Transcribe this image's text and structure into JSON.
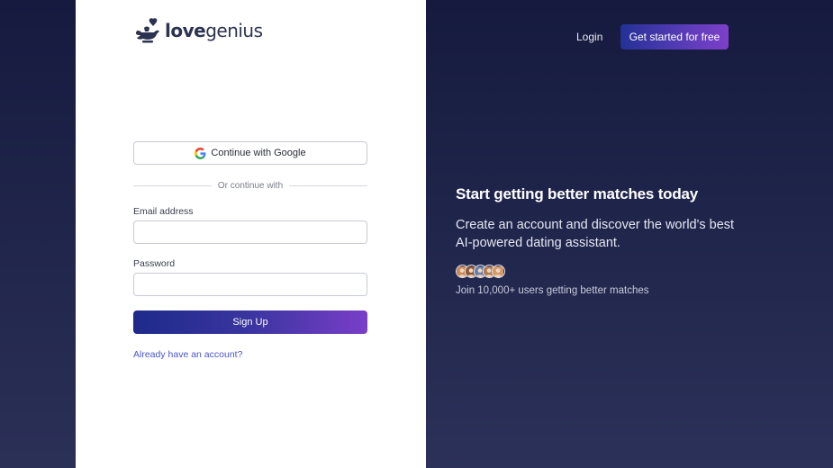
{
  "brand": {
    "name_bold": "love",
    "name_regular": "genius"
  },
  "auth": {
    "google_label": "Continue with Google",
    "divider_text": "Or continue with",
    "email_label": "Email address",
    "email_value": "",
    "password_label": "Password",
    "password_value": "",
    "submit_label": "Sign Up",
    "signin_link": "Already have an account?"
  },
  "nav": {
    "login_label": "Login",
    "cta_label": "Get started for free"
  },
  "hero": {
    "headline": "Start getting better matches today",
    "subheadline": "Create an account and discover the world's best AI-powered dating assistant.",
    "social_proof": "Join 10,000+ users getting better matches"
  },
  "avatars": [
    {
      "icon": "user-avatar-1",
      "color": "#c9895a"
    },
    {
      "icon": "user-avatar-2",
      "color": "#8a5a3c"
    },
    {
      "icon": "user-avatar-3",
      "color": "#6b7fa8"
    },
    {
      "icon": "user-avatar-4",
      "color": "#b07a52"
    },
    {
      "icon": "user-avatar-5",
      "color": "#d29a6a"
    }
  ],
  "colors": {
    "accent_start": "#1e2a8a",
    "accent_end": "#7a3ec8",
    "link": "#4a55c9",
    "background": "#15193d"
  }
}
